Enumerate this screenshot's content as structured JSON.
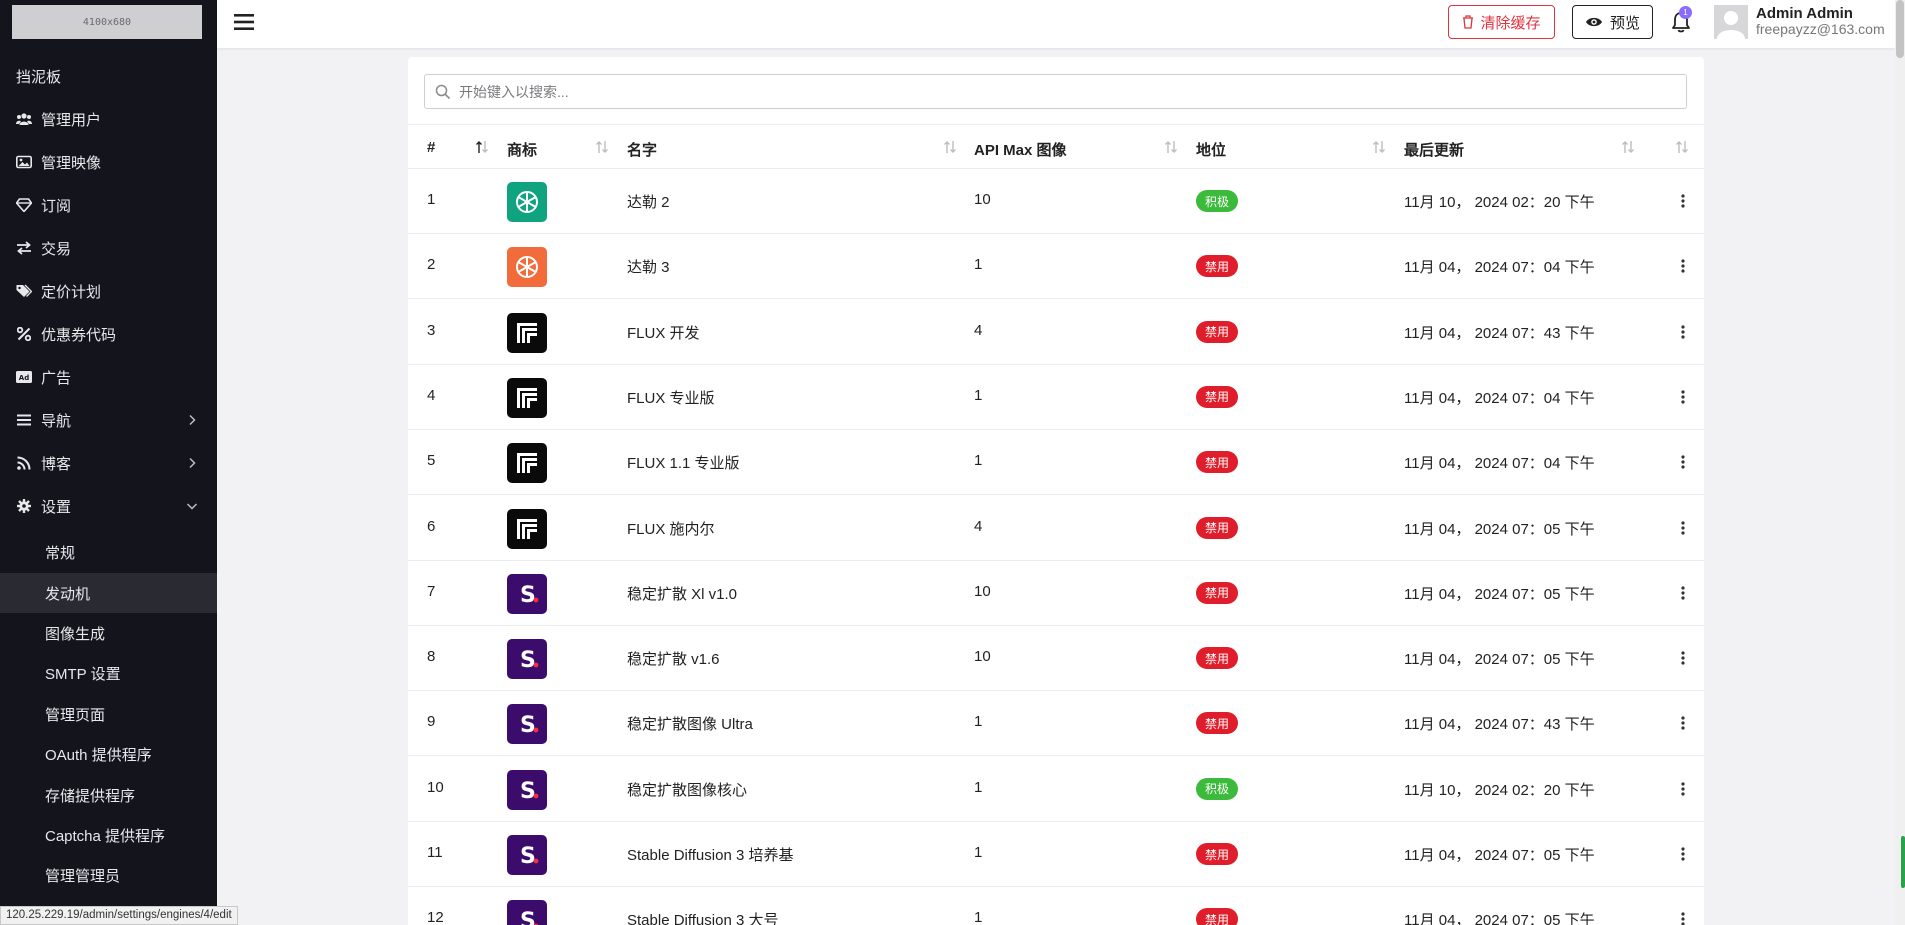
{
  "sidebar": {
    "logo_text": "4100x680",
    "items": [
      {
        "label": "挡泥板",
        "icon": ""
      },
      {
        "label": "管理用户",
        "icon": "users-icon"
      },
      {
        "label": "管理映像",
        "icon": "image-icon"
      },
      {
        "label": "订阅",
        "icon": "gem-icon"
      },
      {
        "label": "交易",
        "icon": "exchange-icon"
      },
      {
        "label": "定价计划",
        "icon": "tags-icon"
      },
      {
        "label": "优惠券代码",
        "icon": "percent-icon"
      },
      {
        "label": "广告",
        "icon": "ad-icon"
      },
      {
        "label": "导航",
        "icon": "list-icon"
      },
      {
        "label": "博客",
        "icon": "rss-icon"
      },
      {
        "label": "设置",
        "icon": "gear-icon"
      }
    ],
    "subitems": [
      "常规",
      "发动机",
      "图像生成",
      "SMTP 设置",
      "管理页面",
      "OAuth 提供程序",
      "存储提供程序",
      "Captcha 提供程序",
      "管理管理员"
    ],
    "active_subitem": "发动机"
  },
  "status_url": "120.25.229.19/admin/settings/engines/4/edit",
  "topbar": {
    "clear_cache": "清除缓存",
    "preview": "预览",
    "notification_count": "1",
    "user_name": "Admin Admin",
    "user_email": "freepayzz@163.com"
  },
  "search": {
    "placeholder": "开始键入以搜索..."
  },
  "table": {
    "headers": [
      "#",
      "商标",
      "名字",
      "API Max 图像",
      "地位",
      "最后更新"
    ],
    "rows": [
      {
        "id": "1",
        "logo": "openai-green",
        "name": "达勒 2",
        "max": "10",
        "status": "积极",
        "status_type": "active",
        "updated": "11月 10， 2024 02：20 下午"
      },
      {
        "id": "2",
        "logo": "openai-orange",
        "name": "达勒 3",
        "max": "1",
        "status": "禁用",
        "status_type": "disabled",
        "updated": "11月 04， 2024 07：04 下午"
      },
      {
        "id": "3",
        "logo": "flux",
        "name": "FLUX 开发",
        "max": "4",
        "status": "禁用",
        "status_type": "disabled",
        "updated": "11月 04， 2024 07：43 下午"
      },
      {
        "id": "4",
        "logo": "flux",
        "name": "FLUX 专业版",
        "max": "1",
        "status": "禁用",
        "status_type": "disabled",
        "updated": "11月 04， 2024 07：04 下午"
      },
      {
        "id": "5",
        "logo": "flux",
        "name": "FLUX 1.1 专业版",
        "max": "1",
        "status": "禁用",
        "status_type": "disabled",
        "updated": "11月 04， 2024 07：04 下午"
      },
      {
        "id": "6",
        "logo": "flux",
        "name": "FLUX 施内尔",
        "max": "4",
        "status": "禁用",
        "status_type": "disabled",
        "updated": "11月 04， 2024 07：05 下午"
      },
      {
        "id": "7",
        "logo": "stability",
        "name": "稳定扩散 Xl v1.0",
        "max": "10",
        "status": "禁用",
        "status_type": "disabled",
        "updated": "11月 04， 2024 07：05 下午"
      },
      {
        "id": "8",
        "logo": "stability",
        "name": "稳定扩散 v1.6",
        "max": "10",
        "status": "禁用",
        "status_type": "disabled",
        "updated": "11月 04， 2024 07：05 下午"
      },
      {
        "id": "9",
        "logo": "stability",
        "name": "稳定扩散图像 Ultra",
        "max": "1",
        "status": "禁用",
        "status_type": "disabled",
        "updated": "11月 04， 2024 07：43 下午"
      },
      {
        "id": "10",
        "logo": "stability",
        "name": "稳定扩散图像核心",
        "max": "1",
        "status": "积极",
        "status_type": "active",
        "updated": "11月 10， 2024 02：20 下午"
      },
      {
        "id": "11",
        "logo": "stability",
        "name": "Stable Diffusion 3 培养基",
        "max": "1",
        "status": "禁用",
        "status_type": "disabled",
        "updated": "11月 04， 2024 07：05 下午"
      },
      {
        "id": "12",
        "logo": "stability",
        "name": "Stable Diffusion 3 大号",
        "max": "1",
        "status": "禁用",
        "status_type": "disabled",
        "updated": "11月 04， 2024 07：05 下午"
      }
    ]
  },
  "colors": {
    "sidebar_bg": "#14141c",
    "active_badge": "#3cba3c",
    "disabled_badge": "#e01e2b",
    "openai_green": "#10a37f",
    "openai_orange": "#f26b3a",
    "stability_purple": "#3b0c6b",
    "danger": "#e0333e"
  }
}
